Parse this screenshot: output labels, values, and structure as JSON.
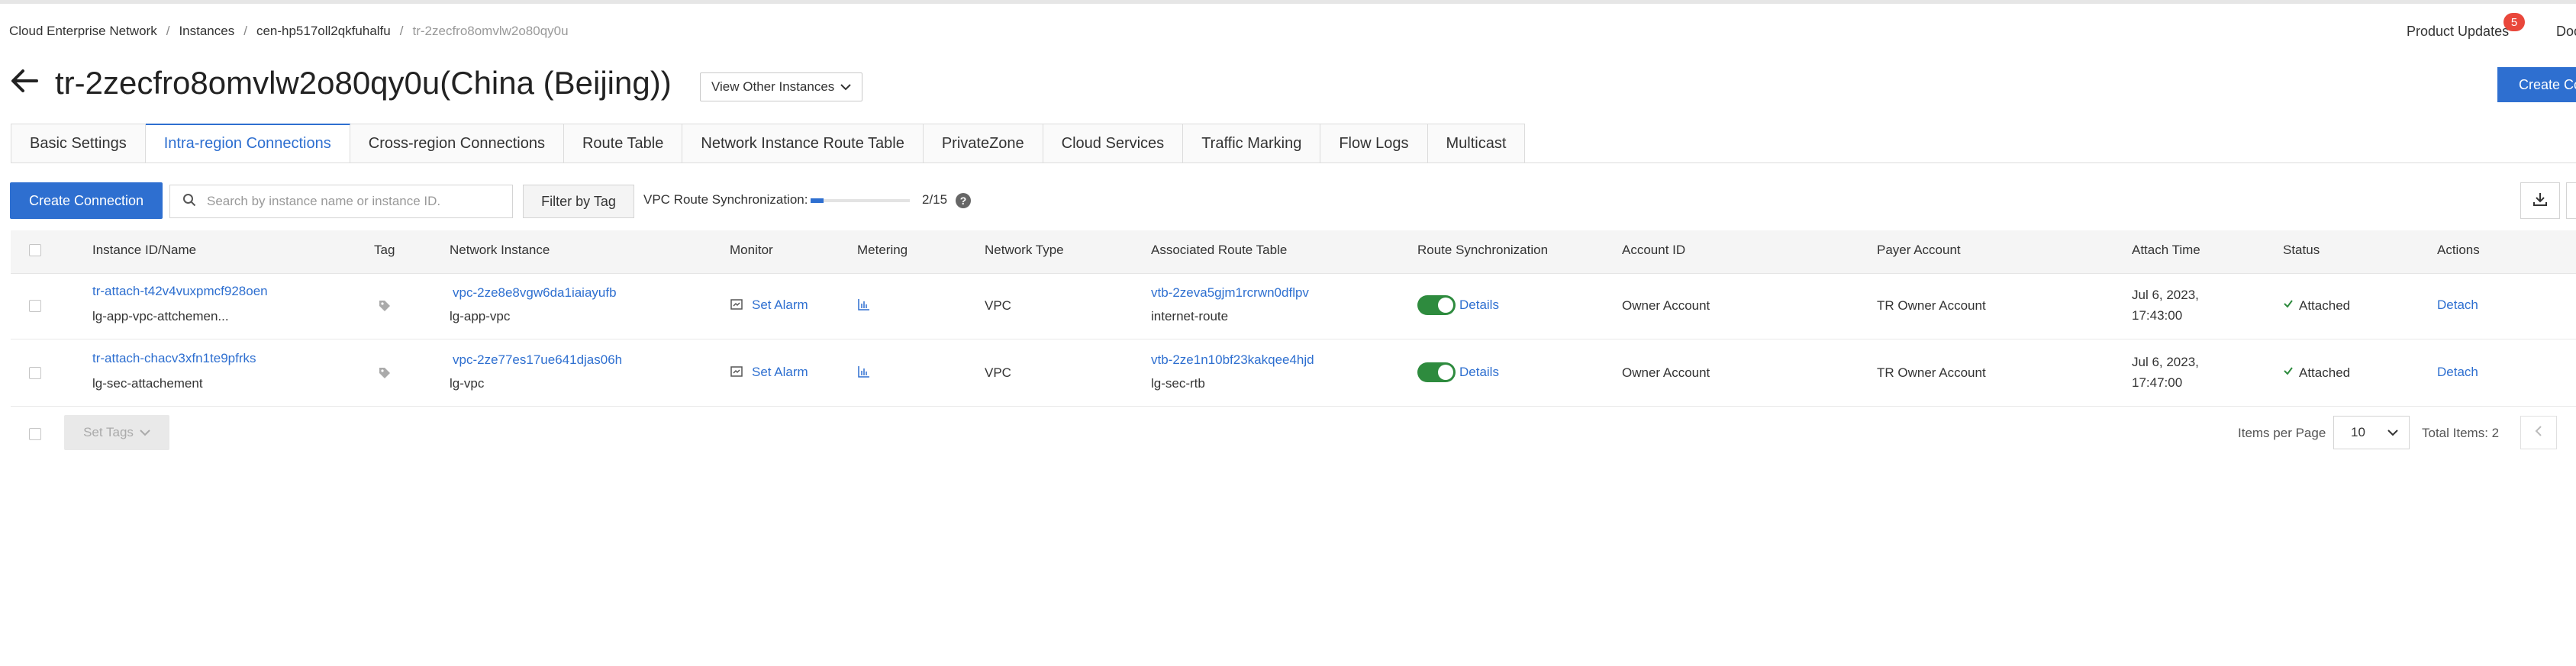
{
  "breadcrumb": {
    "items": [
      "Cloud Enterprise Network",
      "Instances",
      "cen-hp517oll2qkfuhalfu"
    ],
    "current": "tr-2zecfro8omvlw2o80qy0u"
  },
  "header": {
    "product_updates": "Product Updates",
    "updates_badge": "5",
    "docs_label": "Doc",
    "title": "tr-2zecfro8omvlw2o80qy0u(China (Beijing))",
    "view_other_instances": "View Other Instances",
    "create_button": "Create Co"
  },
  "tabs": [
    {
      "label": "Basic Settings",
      "active": false
    },
    {
      "label": "Intra-region Connections",
      "active": true
    },
    {
      "label": "Cross-region Connections",
      "active": false
    },
    {
      "label": "Route Table",
      "active": false
    },
    {
      "label": "Network Instance Route Table",
      "active": false
    },
    {
      "label": "PrivateZone",
      "active": false
    },
    {
      "label": "Cloud Services",
      "active": false
    },
    {
      "label": "Traffic Marking",
      "active": false
    },
    {
      "label": "Flow Logs",
      "active": false
    },
    {
      "label": "Multicast",
      "active": false
    }
  ],
  "toolbar": {
    "create_connection": "Create Connection",
    "search_placeholder": "Search by instance name or instance ID.",
    "filter_by_tag": "Filter by Tag",
    "vpc_sync_label": "VPC Route Synchronization:",
    "vpc_sync_count": "2/15",
    "vpc_sync_fraction": 0.133,
    "help_glyph": "?"
  },
  "table": {
    "columns": {
      "instance": "Instance ID/Name",
      "tag": "Tag",
      "network_instance": "Network Instance",
      "monitor": "Monitor",
      "metering": "Metering",
      "network_type": "Network Type",
      "route_table": "Associated Route Table",
      "route_sync": "Route Synchronization",
      "account_id": "Account ID",
      "payer_account": "Payer Account",
      "attach_time": "Attach Time",
      "status": "Status",
      "actions": "Actions"
    },
    "rows": [
      {
        "instance_id": "tr-attach-t42v4vuxpmcf928oen",
        "instance_name": "lg-app-vpc-attchemen...",
        "network_instance_id": "vpc-2ze8e8vgw6da1iaiayufb",
        "network_instance_name": "lg-app-vpc",
        "monitor": "Set Alarm",
        "network_type": "VPC",
        "route_table_id": "vtb-2zeva5gjm1rcrwn0dflpv",
        "route_table_name": "internet-route",
        "route_sync_on": true,
        "route_sync_details": "Details",
        "account_id": "Owner Account",
        "payer_account": "TR Owner Account",
        "attach_date": "Jul 6, 2023,",
        "attach_time": "17:43:00",
        "status": "Attached",
        "action": "Detach"
      },
      {
        "instance_id": "tr-attach-chacv3xfn1te9pfrks",
        "instance_name": "lg-sec-attachement",
        "network_instance_id": "vpc-2ze77es17ue641djas06h",
        "network_instance_name": "lg-vpc",
        "monitor": "Set Alarm",
        "network_type": "VPC",
        "route_table_id": "vtb-2ze1n10bf23kakqee4hjd",
        "route_table_name": "lg-sec-rtb",
        "route_sync_on": true,
        "route_sync_details": "Details",
        "account_id": "Owner Account",
        "payer_account": "TR Owner Account",
        "attach_date": "Jul 6, 2023,",
        "attach_time": "17:47:00",
        "status": "Attached",
        "action": "Detach"
      }
    ]
  },
  "footer": {
    "set_tags": "Set Tags",
    "items_per_page_label": "Items per Page",
    "items_per_page_value": "10",
    "total_items": "Total Items: 2"
  },
  "colors": {
    "primary": "#2e6fd0",
    "toggle_on": "#2e8b3e",
    "badge": "#e9473b"
  }
}
